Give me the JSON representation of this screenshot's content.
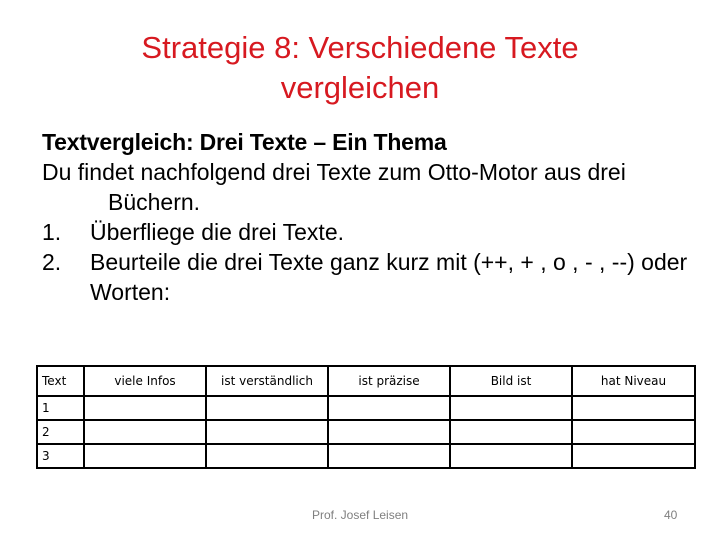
{
  "slide": {
    "title": "Strategie 8: Verschiedene Texte vergleichen",
    "title_color": "#d71920",
    "heading": "Textvergleich: Drei Texte – Ein Thema",
    "intro": "Du findet nachfolgend drei Texte zum Otto-Motor aus drei Büchern.",
    "steps": [
      {
        "number": "1.",
        "text": "Überfliege die drei Texte."
      },
      {
        "number": "2.",
        "text": "Beurteile die drei Texte ganz kurz mit (++, + , o , - , --) oder Worten:"
      }
    ]
  },
  "table": {
    "headers": [
      "Text",
      "viele Infos",
      "ist verständlich",
      "ist präzise",
      "Bild ist",
      "hat Niveau"
    ],
    "rows": [
      [
        "1",
        "",
        "",
        "",
        "",
        ""
      ],
      [
        "2",
        "",
        "",
        "",
        "",
        ""
      ],
      [
        "3",
        "",
        "",
        "",
        "",
        ""
      ]
    ]
  },
  "footer": {
    "author": "Prof. Josef Leisen",
    "page_number": "40",
    "text_color": "#7f7f7f"
  }
}
